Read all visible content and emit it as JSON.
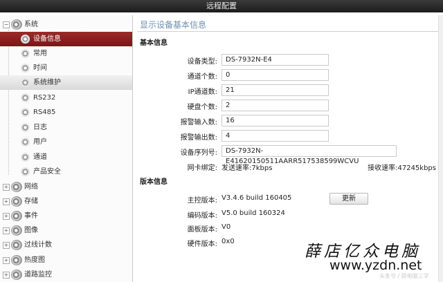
{
  "window": {
    "title": "远程配置"
  },
  "sidebar": {
    "items": [
      {
        "label": "系统",
        "level": 0,
        "expanded": true
      },
      {
        "label": "设备信息",
        "level": 1,
        "selected": true
      },
      {
        "label": "常用",
        "level": 1
      },
      {
        "label": "时间",
        "level": 1
      },
      {
        "label": "系统维护",
        "level": 1,
        "hover": true
      },
      {
        "label": "RS232",
        "level": 1
      },
      {
        "label": "RS485",
        "level": 1
      },
      {
        "label": "日志",
        "level": 1
      },
      {
        "label": "用户",
        "level": 1
      },
      {
        "label": "通道",
        "level": 1
      },
      {
        "label": "产品安全",
        "level": 1
      },
      {
        "label": "网络",
        "level": 0,
        "expanded": false
      },
      {
        "label": "存储",
        "level": 0,
        "expanded": false
      },
      {
        "label": "事件",
        "level": 0,
        "expanded": false
      },
      {
        "label": "图像",
        "level": 0,
        "expanded": false
      },
      {
        "label": "过线计数",
        "level": 0,
        "expanded": false
      },
      {
        "label": "热度图",
        "level": 0,
        "expanded": false
      },
      {
        "label": "道路监控",
        "level": 0,
        "expanded": false
      }
    ]
  },
  "main": {
    "title": "显示设备基本信息",
    "basic": {
      "heading": "基本信息",
      "fields": [
        {
          "label": "设备类型:",
          "value": "DS-7932N-E4"
        },
        {
          "label": "通道个数:",
          "value": "0"
        },
        {
          "label": "IP通道数:",
          "value": "21"
        },
        {
          "label": "硬盘个数:",
          "value": "2"
        },
        {
          "label": "报警输入数:",
          "value": "16"
        },
        {
          "label": "报警输出数:",
          "value": "4"
        },
        {
          "label": "设备序列号:",
          "value": "DS-7932N-E41620150511AARR517538599WCVU"
        }
      ],
      "nic": {
        "label": "网卡绑定:",
        "tx": "发送速率:7kbps",
        "rx": "接收速率:47245kbps"
      }
    },
    "version": {
      "heading": "版本信息",
      "fields": [
        {
          "label": "主控版本:",
          "value": "V3.4.6 build 160405"
        },
        {
          "label": "编码版本:",
          "value": "V5.0 build 160324"
        },
        {
          "label": "面板版本:",
          "value": "V0"
        },
        {
          "label": "硬件版本:",
          "value": "0x0"
        }
      ],
      "update_label": "更新"
    }
  },
  "watermark": {
    "title": "薛店亿众电脑",
    "url": "www.yzdn.net",
    "credit": "头条号 / 薛电脑三学"
  }
}
